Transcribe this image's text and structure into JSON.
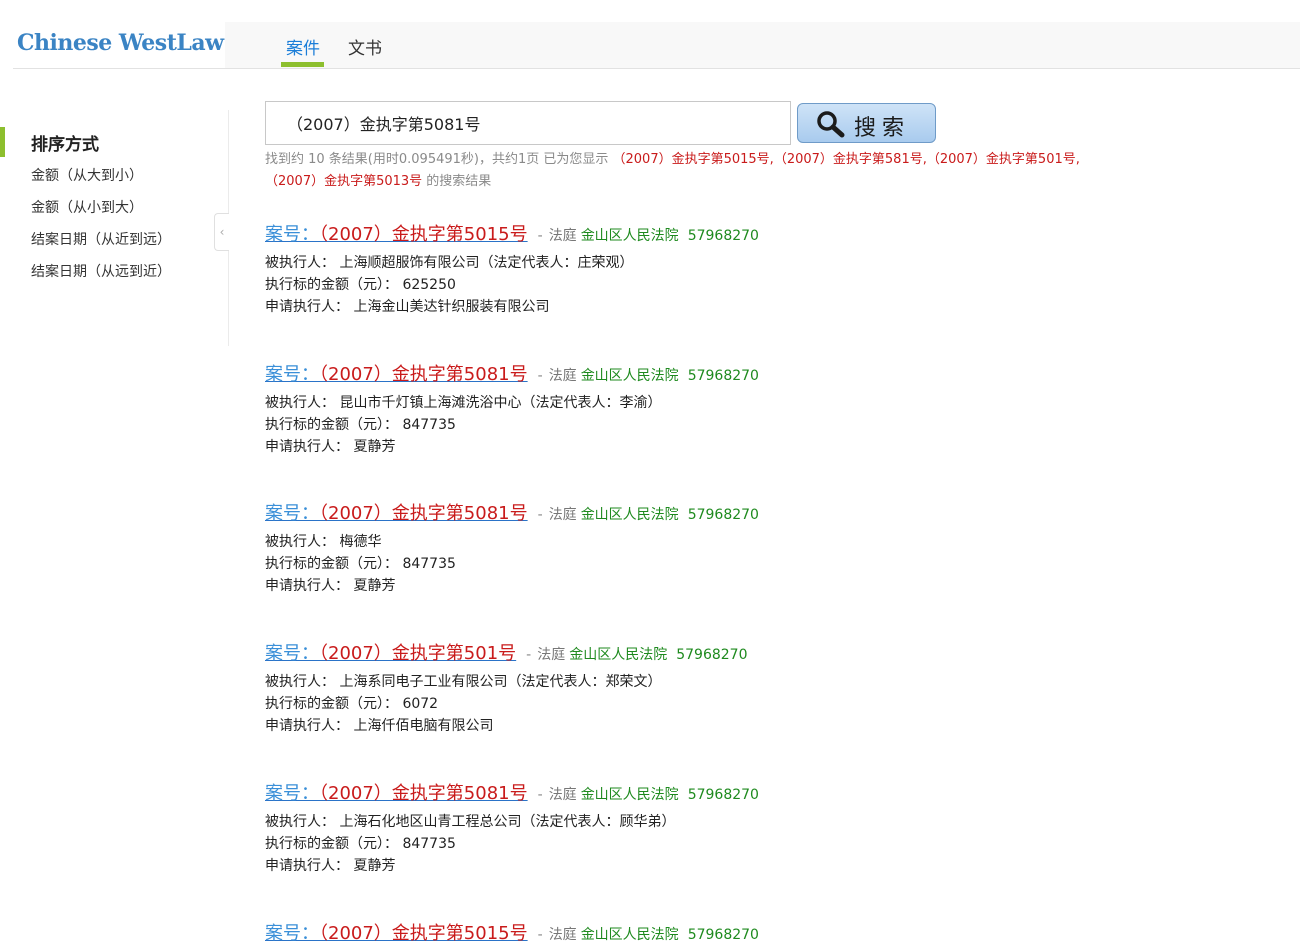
{
  "header": {
    "logo": "Chinese WestLaw",
    "tabs": [
      {
        "label": "案件",
        "active": true
      },
      {
        "label": "文书",
        "active": false
      }
    ]
  },
  "sidebar": {
    "title": "排序方式",
    "items": [
      {
        "label": "金额（从大到小）"
      },
      {
        "label": "金额（从小到大）"
      },
      {
        "label": "结案日期（从近到远）"
      },
      {
        "label": "结案日期（从远到近）"
      }
    ],
    "collapse_icon": "‹"
  },
  "search": {
    "value": "（2007）金执字第5081号",
    "button_label": "搜索",
    "summary_prefix": "找到约 10 条结果(用时0.095491秒)，共约1页 已为您显示 ",
    "summary_highlight": "（2007）金执字第5015号,（2007）金执字第581号,（2007）金执字第501号,（2007）金执字第5013号",
    "summary_suffix": " 的搜索结果"
  },
  "results": [
    {
      "case_prefix": "案号：",
      "case_no": "（2007）金执字第5015号",
      "dash": "-",
      "court_label": "法庭",
      "court": "金山区人民法院",
      "phone": "57968270",
      "line1_label": "被执行人：",
      "line1_value": "上海顺超服饰有限公司（法定代表人：庄荣观）",
      "line2_label": "执行标的金额（元）：",
      "line2_value": "625250",
      "line3_label": "申请执行人：",
      "line3_value": "上海金山美达针织服装有限公司"
    },
    {
      "case_prefix": "案号：",
      "case_no": "（2007）金执字第5081号",
      "dash": "-",
      "court_label": "法庭",
      "court": "金山区人民法院",
      "phone": "57968270",
      "line1_label": "被执行人：",
      "line1_value": "昆山市千灯镇上海滩洗浴中心（法定代表人：李渝）",
      "line2_label": "执行标的金额（元）：",
      "line2_value": "847735",
      "line3_label": "申请执行人：",
      "line3_value": "夏静芳"
    },
    {
      "case_prefix": "案号：",
      "case_no": "（2007）金执字第5081号",
      "dash": "-",
      "court_label": "法庭",
      "court": "金山区人民法院",
      "phone": "57968270",
      "line1_label": "被执行人：",
      "line1_value": "梅德华",
      "line2_label": "执行标的金额（元）：",
      "line2_value": "847735",
      "line3_label": "申请执行人：",
      "line3_value": "夏静芳"
    },
    {
      "case_prefix": "案号：",
      "case_no": "（2007）金执字第501号",
      "dash": "-",
      "court_label": "法庭",
      "court": "金山区人民法院",
      "phone": "57968270",
      "line1_label": "被执行人：",
      "line1_value": "上海系同电子工业有限公司（法定代表人：郑荣文）",
      "line2_label": "执行标的金额（元）：",
      "line2_value": "6072",
      "line3_label": "申请执行人：",
      "line3_value": "上海仟佰电脑有限公司"
    },
    {
      "case_prefix": "案号：",
      "case_no": "（2007）金执字第5081号",
      "dash": "-",
      "court_label": "法庭",
      "court": "金山区人民法院",
      "phone": "57968270",
      "line1_label": "被执行人：",
      "line1_value": "上海石化地区山青工程总公司（法定代表人：顾华弟）",
      "line2_label": "执行标的金额（元）：",
      "line2_value": "847735",
      "line3_label": "申请执行人：",
      "line3_value": "夏静芳"
    },
    {
      "case_prefix": "案号：",
      "case_no": "（2007）金执字第5015号",
      "dash": "-",
      "court_label": "法庭",
      "court": "金山区人民法院",
      "phone": "57968270"
    }
  ]
}
